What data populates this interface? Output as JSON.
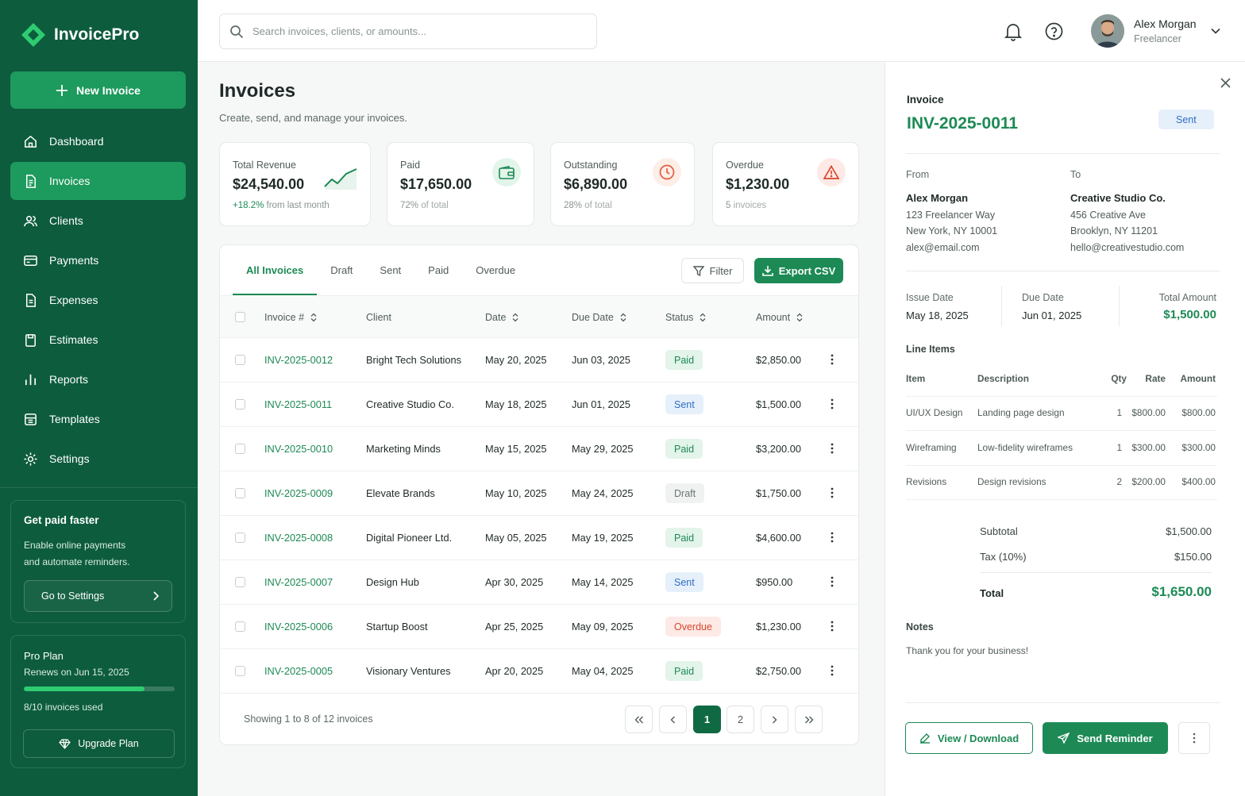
{
  "brand": {
    "name": "InvoicePro",
    "accent": "#1d8a55",
    "sidebar_bg": "#0d5c3e"
  },
  "sidebar": {
    "new_invoice": "New Invoice",
    "items": [
      {
        "label": "Dashboard",
        "icon": "home-icon"
      },
      {
        "label": "Invoices",
        "icon": "file-icon",
        "active": true
      },
      {
        "label": "Clients",
        "icon": "users-icon"
      },
      {
        "label": "Payments",
        "icon": "credit-card-icon"
      },
      {
        "label": "Expenses",
        "icon": "receipt-icon"
      },
      {
        "label": "Estimates",
        "icon": "clipboard-icon"
      },
      {
        "label": "Reports",
        "icon": "bar-chart-icon"
      },
      {
        "label": "Templates",
        "icon": "template-icon"
      },
      {
        "label": "Settings",
        "icon": "gear-icon"
      }
    ],
    "promo": {
      "title": "Get paid faster",
      "line1": "Enable online payments",
      "line2": "and automate reminders.",
      "button": "Go to Settings"
    },
    "plan": {
      "title": "Pro Plan",
      "renews": "Renews on Jun 15, 2025",
      "usage": "8/10 invoices used",
      "usage_fraction": 0.8,
      "button": "Upgrade Plan"
    }
  },
  "topbar": {
    "search_placeholder": "Search invoices, clients, or amounts...",
    "user_name": "Alex Morgan",
    "user_role": "Freelancer"
  },
  "page": {
    "title": "Invoices",
    "subtitle": "Create, send, and manage your invoices."
  },
  "stats": [
    {
      "label": "Total Revenue",
      "value": "$24,540.00",
      "sub_highlight": "+18.2%",
      "sub": "from last month",
      "icon": "trend-up-icon"
    },
    {
      "label": "Paid",
      "value": "$17,650.00",
      "sub_highlight": "72%",
      "sub": "of total",
      "icon": "wallet-icon"
    },
    {
      "label": "Outstanding",
      "value": "$6,890.00",
      "sub_highlight": "28%",
      "sub": "of total",
      "icon": "clock-icon"
    },
    {
      "label": "Overdue",
      "value": "$1,230.00",
      "sub_highlight": "5",
      "sub": "invoices",
      "icon": "warning-icon"
    }
  ],
  "tabs": [
    "All Invoices",
    "Draft",
    "Sent",
    "Paid",
    "Overdue"
  ],
  "toolbar": {
    "filter": "Filter",
    "export": "Export CSV"
  },
  "table": {
    "headers": [
      "Invoice #",
      "Client",
      "Date",
      "Due Date",
      "Status",
      "Amount"
    ],
    "rows": [
      {
        "id": "INV-2025-0012",
        "client": "Bright Tech Solutions",
        "date": "May 20, 2025",
        "due": "Jun 03, 2025",
        "status": "Paid",
        "amount": "$2,850.00"
      },
      {
        "id": "INV-2025-0011",
        "client": "Creative Studio Co.",
        "date": "May 18, 2025",
        "due": "Jun 01, 2025",
        "status": "Sent",
        "amount": "$1,500.00"
      },
      {
        "id": "INV-2025-0010",
        "client": "Marketing Minds",
        "date": "May 15, 2025",
        "due": "May 29, 2025",
        "status": "Paid",
        "amount": "$3,200.00"
      },
      {
        "id": "INV-2025-0009",
        "client": "Elevate Brands",
        "date": "May 10, 2025",
        "due": "May 24, 2025",
        "status": "Draft",
        "amount": "$1,750.00"
      },
      {
        "id": "INV-2025-0008",
        "client": "Digital Pioneer Ltd.",
        "date": "May 05, 2025",
        "due": "May 19, 2025",
        "status": "Paid",
        "amount": "$4,600.00"
      },
      {
        "id": "INV-2025-0007",
        "client": "Design Hub",
        "date": "Apr 30, 2025",
        "due": "May 14, 2025",
        "status": "Sent",
        "amount": "$950.00"
      },
      {
        "id": "INV-2025-0006",
        "client": "Startup Boost",
        "date": "Apr 25, 2025",
        "due": "May 09, 2025",
        "status": "Overdue",
        "amount": "$1,230.00"
      },
      {
        "id": "INV-2025-0005",
        "client": "Visionary Ventures",
        "date": "Apr 20, 2025",
        "due": "May 04, 2025",
        "status": "Paid",
        "amount": "$2,750.00"
      }
    ]
  },
  "pagination": {
    "info": "Showing 1 to 8 of 12 invoices",
    "pages": [
      "1",
      "2"
    ],
    "current": "1"
  },
  "detail": {
    "label": "Invoice",
    "id": "INV-2025-0011",
    "status": "Sent",
    "from_label": "From",
    "to_label": "To",
    "from": {
      "name": "Alex Morgan",
      "line1": "123 Freelancer Way",
      "line2": "New York, NY 10001",
      "email": "alex@email.com"
    },
    "to": {
      "name": "Creative Studio Co.",
      "line1": "456 Creative Ave",
      "line2": "Brooklyn, NY 11201",
      "email": "hello@creativestudio.com"
    },
    "issue_label": "Issue Date",
    "issue_date": "May 18, 2025",
    "due_label": "Due Date",
    "due_date": "Jun 01, 2025",
    "total_label": "Total Amount",
    "total_amount": "$1,500.00",
    "line_items_title": "Line Items",
    "line_headers": [
      "Item",
      "Description",
      "Qty",
      "Rate",
      "Amount"
    ],
    "line_items": [
      {
        "item": "UI/UX Design",
        "desc": "Landing page design",
        "qty": "1",
        "rate": "$800.00",
        "amount": "$800.00"
      },
      {
        "item": "Wireframing",
        "desc": "Low-fidelity wireframes",
        "qty": "1",
        "rate": "$300.00",
        "amount": "$300.00"
      },
      {
        "item": "Revisions",
        "desc": "Design revisions",
        "qty": "2",
        "rate": "$200.00",
        "amount": "$400.00"
      }
    ],
    "subtotal_label": "Subtotal",
    "subtotal": "$1,500.00",
    "tax_label": "Tax (10%)",
    "tax": "$150.00",
    "grand_label": "Total",
    "grand_total": "$1,650.00",
    "notes_label": "Notes",
    "notes": "Thank you for your business!",
    "view_button": "View / Download",
    "remind_button": "Send Reminder"
  }
}
